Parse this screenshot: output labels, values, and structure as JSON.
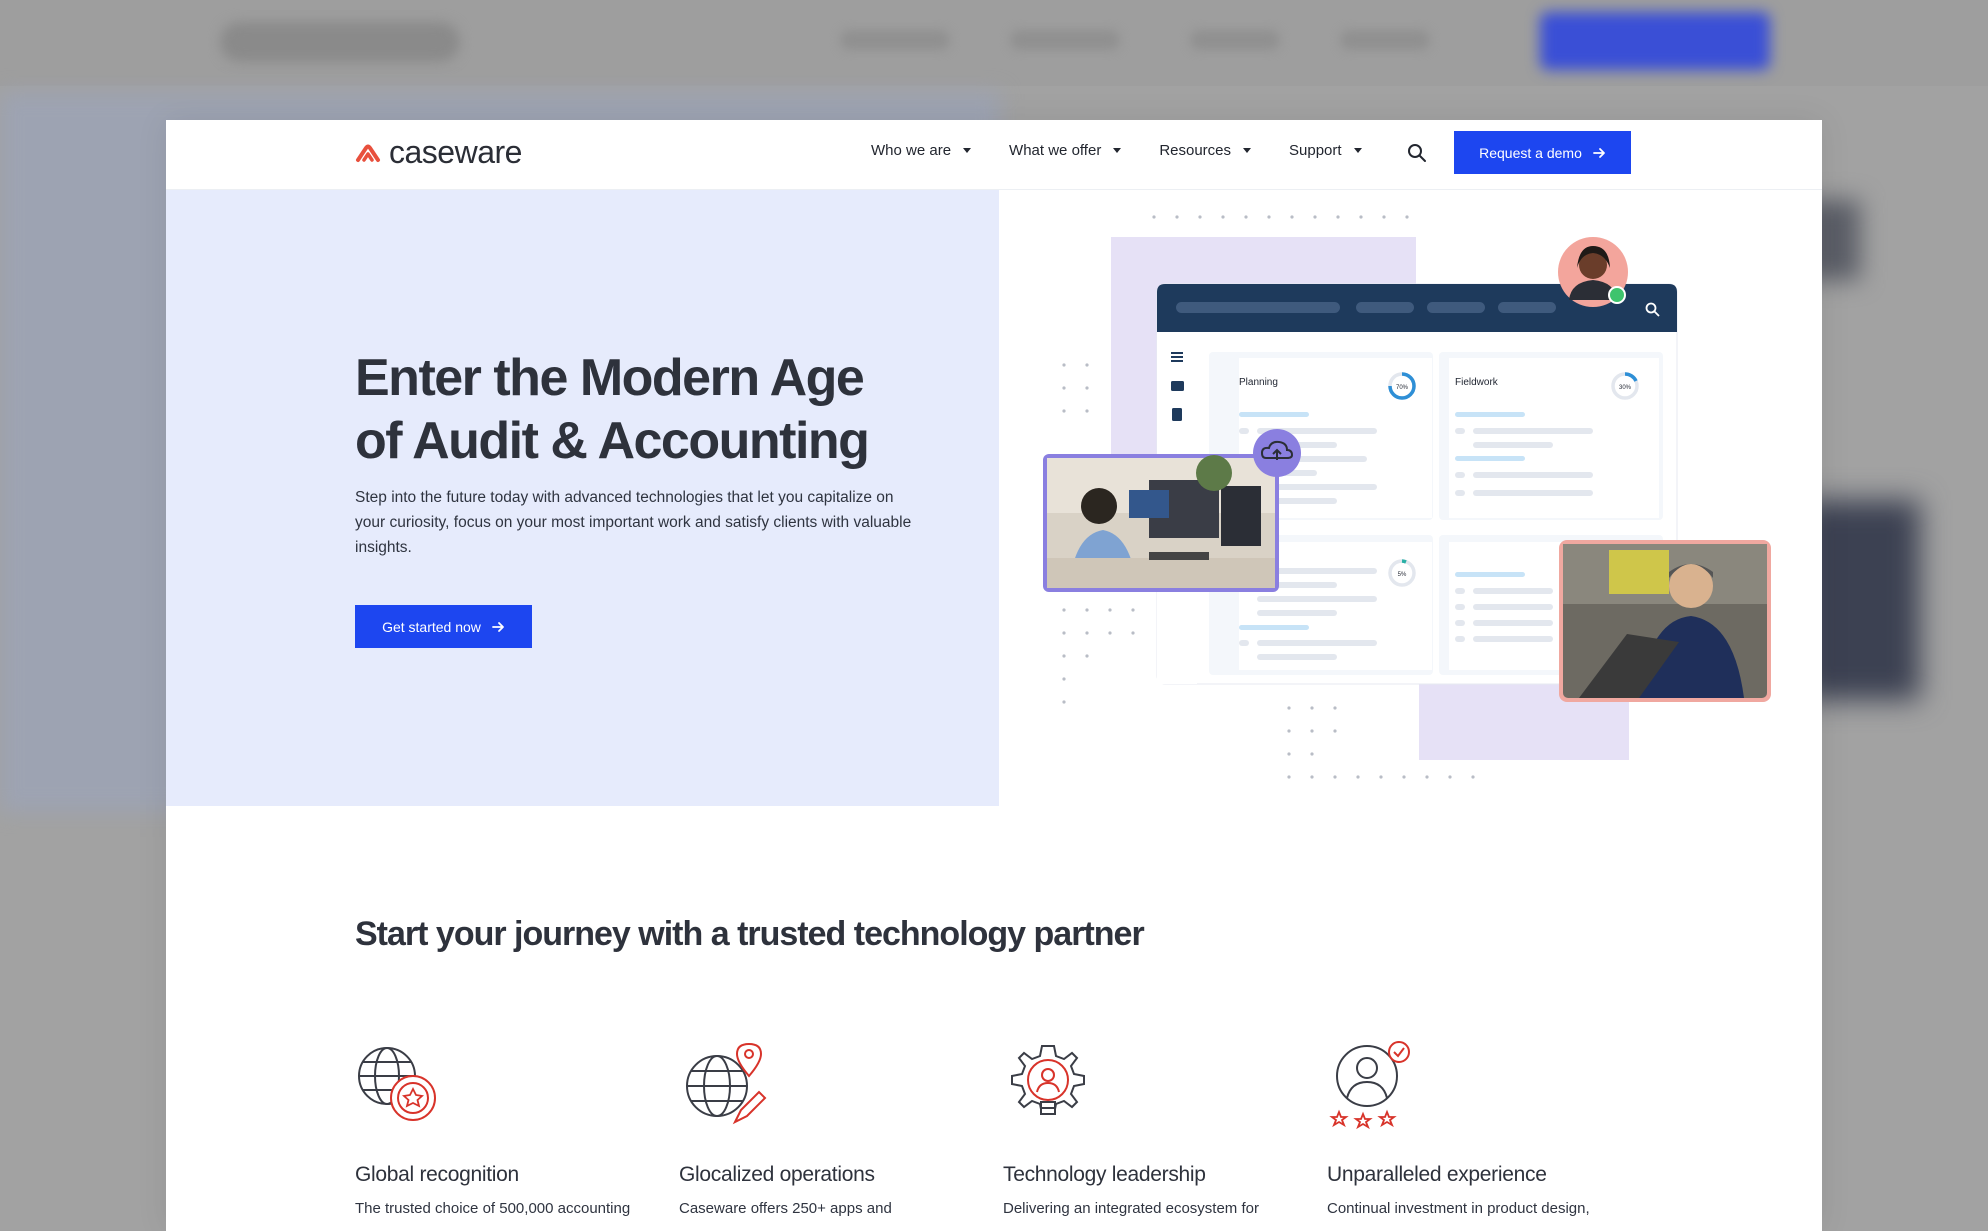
{
  "brand": {
    "name": "caseware",
    "accent": "#1d46f0",
    "logo_color": "#e8503d"
  },
  "nav": {
    "items": [
      {
        "label": "Who we are"
      },
      {
        "label": "What we offer"
      },
      {
        "label": "Resources"
      },
      {
        "label": "Support"
      }
    ],
    "search_icon": "search-icon",
    "cta_label": "Request a demo"
  },
  "hero": {
    "title_line1": "Enter the Modern Age",
    "title_line2": "of Audit & Accounting",
    "subtitle": "Step into the future today with advanced technologies that let you capitalize on your curiosity, focus on your most important work and satisfy clients with valuable insights.",
    "cta_label": "Get started now",
    "illustration": {
      "card1_title": "Planning",
      "card2_title": "Fieldwork",
      "card1_progress": "70%",
      "card2_progress": "30%",
      "card3_progress": "5%"
    }
  },
  "section": {
    "title": "Start your journey with a trusted technology partner",
    "features": [
      {
        "title": "Global recognition",
        "text": "The trusted choice of 500,000 accounting",
        "icon": "globe-award-icon"
      },
      {
        "title": "Glocalized operations",
        "text": "Caseware offers 250+ apps and",
        "icon": "globe-pin-icon"
      },
      {
        "title": "Technology leadership",
        "text": "Delivering an integrated ecosystem for",
        "icon": "gear-bulb-icon"
      },
      {
        "title": "Unparalleled experience",
        "text": "Continual investment in product design,",
        "icon": "user-stars-icon"
      }
    ]
  }
}
